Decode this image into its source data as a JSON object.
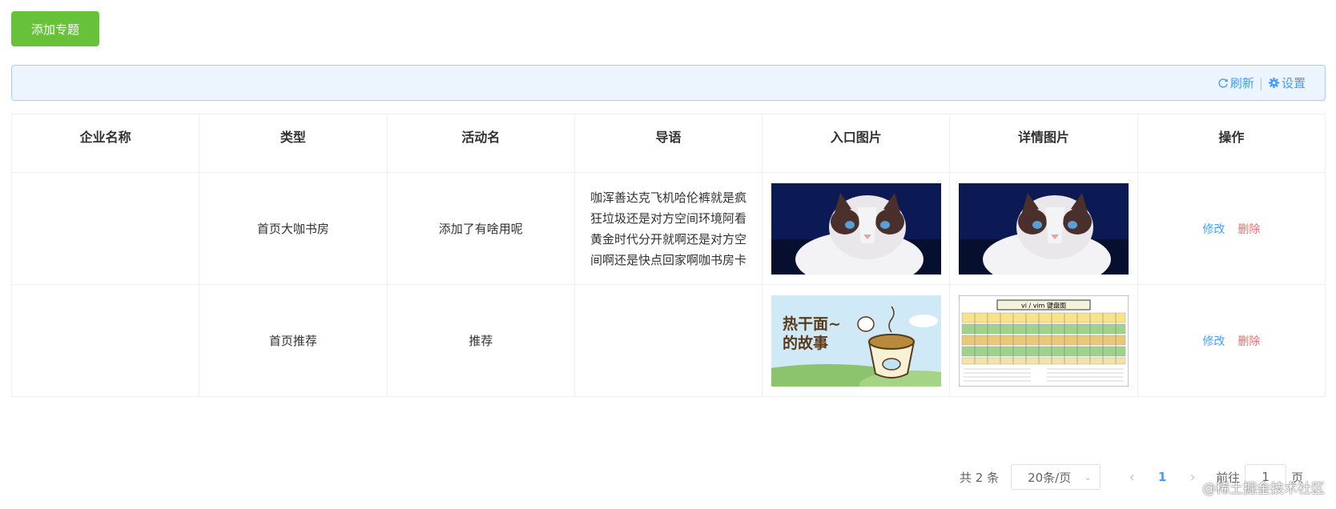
{
  "actions": {
    "add_label": "添加专题"
  },
  "toolbar": {
    "refresh_label": "刷新",
    "separator": "|",
    "settings_label": "设置",
    "refresh_icon": "refresh-icon",
    "settings_icon": "gear-icon"
  },
  "table": {
    "headers": [
      "企业名称",
      "类型",
      "活动名",
      "导语",
      "入口图片",
      "详情图片",
      "操作"
    ],
    "rows": [
      {
        "company": "",
        "type": "首页大咖书房",
        "activity": "添加了有啥用呢",
        "intro": "咖浑善达克飞机哈伦裤就是疯狂垃圾还是对方空间环境阿看黄金时代分开就啊还是对方空间啊还是快点回家啊咖书房卡",
        "entry_image": "ragdoll cat photo",
        "detail_image": "ragdoll cat photo",
        "edit_label": "修改",
        "delete_label": "删除"
      },
      {
        "company": "",
        "type": "首页推荐",
        "activity": "推荐",
        "intro": "",
        "entry_image": "noodle bowl cartoon",
        "detail_image": "vi/vim keyboard chart",
        "entry_image_text": "热干面~的故事",
        "detail_image_text": "vi / vim 键盘图",
        "edit_label": "修改",
        "delete_label": "删除"
      }
    ]
  },
  "pagination": {
    "total_label": "共 2 条",
    "page_size": "20条/页",
    "current_page": "1",
    "goto_label": "前往",
    "jump_value": "1",
    "page_suffix": "页"
  },
  "watermark": "@稀土掘金技术社区",
  "colors": {
    "primary": "#409eff",
    "success": "#67c23a",
    "danger": "#f56c6c",
    "toolbar_bg": "#ecf5ff"
  }
}
